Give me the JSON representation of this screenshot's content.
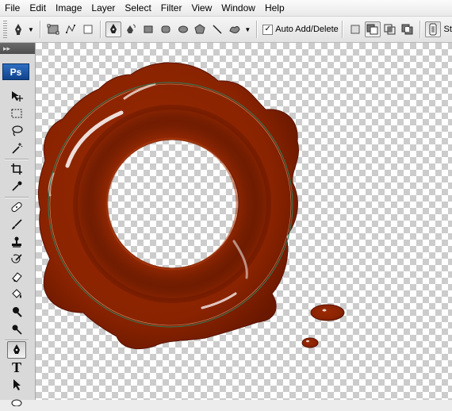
{
  "menubar": {
    "items": [
      "File",
      "Edit",
      "Image",
      "Layer",
      "Select",
      "Filter",
      "View",
      "Window",
      "Help"
    ]
  },
  "optionsbar": {
    "auto_add_delete_label": "Auto Add/Delete",
    "auto_add_delete_checked": true,
    "style_label": "St"
  },
  "toolspanel": {
    "collapse_glyph": "▸▸",
    "logo_text": "Ps",
    "tools": [
      "move-tool-icon",
      "marquee-tool-icon",
      "lasso-tool-icon",
      "magic-wand-tool-icon",
      "crop-tool-icon",
      "eyedropper-tool-icon",
      "healing-brush-tool-icon",
      "brush-tool-icon",
      "clone-stamp-tool-icon",
      "history-brush-tool-icon",
      "eraser-tool-icon",
      "paint-bucket-tool-icon",
      "dodge-tool-icon",
      "pen-tool-icon",
      "type-tool-icon",
      "path-selection-tool-icon"
    ],
    "type_tool_glyph": "T",
    "active_tool": "pen-tool-icon"
  },
  "canvas": {
    "background": "transparent-checkerboard",
    "wax_color": "#8a2300",
    "path_color": "#2e7d5b"
  }
}
